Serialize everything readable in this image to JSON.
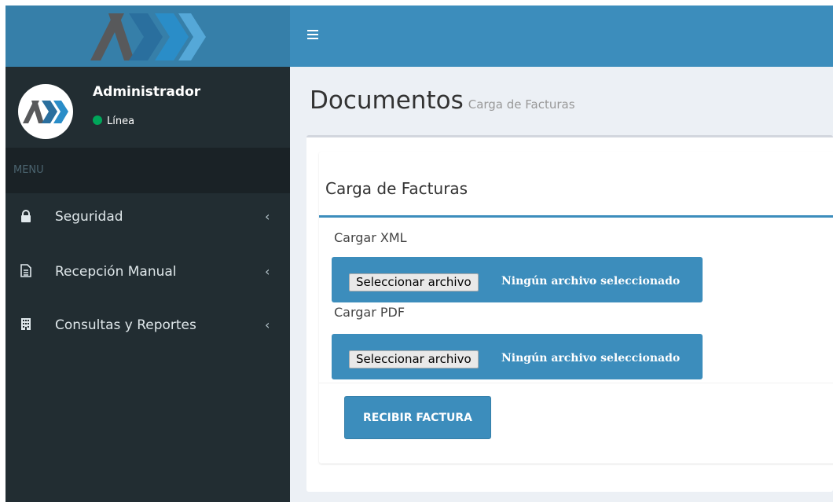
{
  "header": {
    "menu_icon": "hamburger-icon"
  },
  "user": {
    "name": "Administrador",
    "status": "Línea"
  },
  "sidebar": {
    "menu_header": "MENU",
    "items": [
      {
        "label": "Seguridad",
        "icon": "lock-icon"
      },
      {
        "label": "Recepción Manual",
        "icon": "document-icon"
      },
      {
        "label": "Consultas y Reportes",
        "icon": "building-icon"
      }
    ]
  },
  "content": {
    "title": "Documentos",
    "subtitle": "Carga de Facturas",
    "box_title": "Carga de Facturas",
    "xml_label": "Cargar XML",
    "pdf_label": "Cargar PDF",
    "file_button": "Seleccionar archivo",
    "no_file_text": "Ningún archivo seleccionado",
    "submit_label": "RECIBIR FACTURA"
  },
  "colors": {
    "primary": "#3c8dbc",
    "primary_dark": "#367fa9",
    "sidebar_bg": "#222d32",
    "status_online": "#00a65a"
  }
}
